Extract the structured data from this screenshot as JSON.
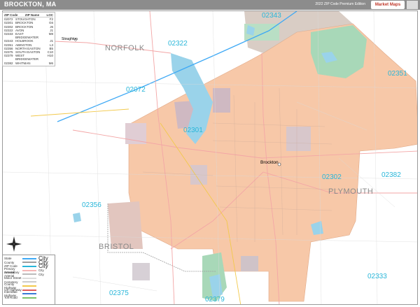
{
  "header": {
    "title": "BROCKTON, MA",
    "edition": "2022 ZIP Code Premium Edition",
    "logo_text": "Market Maps"
  },
  "zip_legend": {
    "col_zip": "ZIP Code",
    "col_name": "ZIP Name",
    "col_loc": "LOC",
    "rows": [
      {
        "zip": "02072",
        "name": "STOUGHTON",
        "loc": "F2"
      },
      {
        "zip": "02301",
        "name": "BROCKTON",
        "loc": "G6"
      },
      {
        "zip": "02302",
        "name": "BROCKTON",
        "loc": "J6"
      },
      {
        "zip": "02322",
        "name": "AVON",
        "loc": "J1"
      },
      {
        "zip": "02333",
        "name": "EAST BRIDGEWATER",
        "loc": "M8"
      },
      {
        "zip": "02343",
        "name": "HOLBROOK",
        "loc": "J1"
      },
      {
        "zip": "02351",
        "name": "ABINGTON",
        "loc": "L3"
      },
      {
        "zip": "02356",
        "name": "NORTH EASTON",
        "loc": "B5"
      },
      {
        "zip": "02375",
        "name": "SOUTH EASTON",
        "loc": "C10"
      },
      {
        "zip": "02379",
        "name": "WEST BRIDGEWATER",
        "loc": "H10"
      },
      {
        "zip": "02382",
        "name": "WHITMAN",
        "loc": "M6"
      }
    ]
  },
  "map_legend": {
    "rows": [
      {
        "label": "State",
        "color": "#3fa9f5",
        "sample": "City"
      },
      {
        "label": "County",
        "color": "#9e9e9e",
        "sample": "City"
      },
      {
        "label": "ZIP Code",
        "color": "#29b6d9",
        "sample": "City"
      },
      {
        "label": "Primary Arterial",
        "color": "#f4b6b6",
        "sample": "City"
      },
      {
        "label": "Secondary Arterial",
        "color": "#bbbbbb",
        "sample": "City"
      },
      {
        "label": "Minor Street",
        "color": "#dddddd",
        "sample": ""
      },
      {
        "label": "Cemetery",
        "color": "#cccccc",
        "sample": ""
      },
      {
        "label": "County Highway",
        "color": "#f2c94c",
        "sample": ""
      },
      {
        "label": "US Highway",
        "color": "#e05a5a",
        "sample": ""
      },
      {
        "label": "Interstate Highway",
        "color": "#3a7bd5",
        "sample": ""
      },
      {
        "label": "Toll Road",
        "color": "#7cc36b",
        "sample": ""
      }
    ]
  },
  "zips": [
    {
      "code": "02343",
      "name": "zip-02343-label"
    },
    {
      "code": "02322",
      "name": "zip-02322-label"
    },
    {
      "code": "02351",
      "name": "zip-02351-label"
    },
    {
      "code": "02072",
      "name": "zip-02072-label"
    },
    {
      "code": "02301",
      "name": "zip-02301-label"
    },
    {
      "code": "02302",
      "name": "zip-02302-label"
    },
    {
      "code": "02382",
      "name": "zip-02382-label"
    },
    {
      "code": "02356",
      "name": "zip-02356-label"
    },
    {
      "code": "02333",
      "name": "zip-02333-label"
    },
    {
      "code": "02375",
      "name": "zip-02375-label"
    },
    {
      "code": "02379",
      "name": "zip-02379-label"
    }
  ],
  "counties": {
    "norfolk": "NORFOLK",
    "plymouth": "PLYMOUTH",
    "bristol": "BRISTOL"
  },
  "cities": {
    "brockton": "Brockton",
    "stoughton": "Stoughton"
  },
  "colors": {
    "brockton_zone": "#f7c8a8",
    "parks": "#a8d8b8",
    "water": "#9ad3ea",
    "zip_label": "#29b6d9"
  }
}
